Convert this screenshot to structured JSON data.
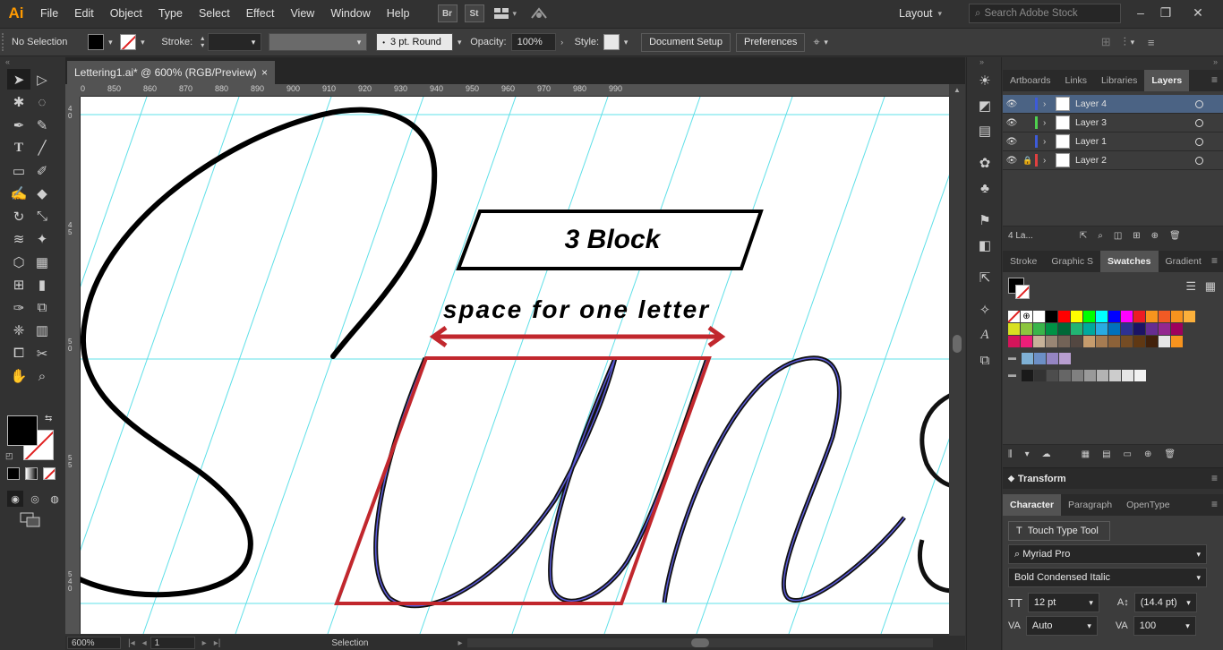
{
  "app": {
    "logo": "Ai"
  },
  "menu": [
    "File",
    "Edit",
    "Object",
    "Type",
    "Select",
    "Effect",
    "View",
    "Window",
    "Help"
  ],
  "menubar_icons": {
    "bridge": "Br",
    "stock": "St",
    "arrange": "arrange-documents-icon",
    "gpu": "gpu-performance-icon"
  },
  "workspace": {
    "label": "Layout"
  },
  "search": {
    "placeholder": "Search Adobe Stock"
  },
  "window_controls": {
    "minimize": "–",
    "restore": "❐",
    "close": "✕"
  },
  "control_bar": {
    "selection_label": "No Selection",
    "stroke_label": "Stroke:",
    "brush_label": "3 pt. Round",
    "opacity_label": "Opacity:",
    "opacity_value": "100%",
    "style_label": "Style:",
    "document_setup": "Document Setup",
    "preferences": "Preferences"
  },
  "document": {
    "tab_title": "Lettering1.ai* @ 600% (RGB/Preview)",
    "close": "×"
  },
  "ruler_h_ticks": [
    "840",
    "850",
    "860",
    "870",
    "880",
    "890",
    "900",
    "910",
    "920",
    "930",
    "940",
    "950",
    "960",
    "970",
    "980",
    "990"
  ],
  "ruler_v_ticks": [
    "4 0",
    "4 5",
    "5 0",
    "5 5",
    "5 4 0"
  ],
  "artwork": {
    "block_label": "3 Block",
    "annotation": "space for one letter",
    "colors": {
      "guide": "#5fe0e8",
      "stroke": "#000000",
      "highlight": "#c1272d",
      "outline": "#5a5ad8"
    }
  },
  "status_bar": {
    "zoom": "600%",
    "artboard": "1",
    "tool": "Selection"
  },
  "layers_panel": {
    "tabs": [
      "Artboards",
      "Links",
      "Libraries",
      "Layers"
    ],
    "active_tab": "Layers",
    "layers": [
      {
        "name": "Layer 4",
        "color": "#3d5bd9",
        "locked": false,
        "selected": true
      },
      {
        "name": "Layer 3",
        "color": "#4fd14f",
        "locked": false,
        "selected": false
      },
      {
        "name": "Layer 1",
        "color": "#3d5bd9",
        "locked": false,
        "selected": false
      },
      {
        "name": "Layer 2",
        "color": "#e04040",
        "locked": true,
        "selected": false
      }
    ],
    "footer_count": "4 La..."
  },
  "swatches_panel": {
    "tabs": [
      "Stroke",
      "Graphic S",
      "Swatches",
      "Gradient"
    ],
    "active_tab": "Swatches",
    "row1": [
      "#ffffff",
      "#000000",
      "#ff0000",
      "#ffff00",
      "#00ff00",
      "#00ffff",
      "#0000ff",
      "#ff00ff",
      "#ed1c24",
      "#f7941d",
      "#f15a24",
      "#f7931e",
      "#fbb03b"
    ],
    "row2": [
      "#d9e021",
      "#8cc63f",
      "#39b54a",
      "#009245",
      "#006837",
      "#22b573",
      "#00a99d",
      "#29abe2",
      "#0071bc",
      "#2e3192",
      "#1b1464",
      "#662d91",
      "#93278f",
      "#9e005d"
    ],
    "row3": [
      "#d4145a",
      "#ed1e79",
      "#c7b299",
      "#998675",
      "#736357",
      "#534741",
      "#c69c6d",
      "#a67c52",
      "#8c6239",
      "#754c24",
      "#603813",
      "#42210b",
      "#e6e6e6",
      "#f7931e"
    ],
    "row4": [
      "#7fb1d6",
      "#6c8fc6",
      "#9585c3",
      "#b89ed0"
    ],
    "row5": [
      "#1a1a1a",
      "#333333",
      "#4d4d4d",
      "#666666",
      "#808080",
      "#999999",
      "#b3b3b3",
      "#cccccc",
      "#e6e6e6",
      "#f2f2f2"
    ]
  },
  "transform_panel": {
    "title": "Transform"
  },
  "character_panel": {
    "tabs": [
      "Character",
      "Paragraph",
      "OpenType"
    ],
    "touch_type": "Touch Type Tool",
    "font_family": "Myriad Pro",
    "font_style": "Bold Condensed Italic",
    "font_size": "12 pt",
    "leading": "(14.4 pt)",
    "kerning": "Auto",
    "tracking": "100"
  }
}
